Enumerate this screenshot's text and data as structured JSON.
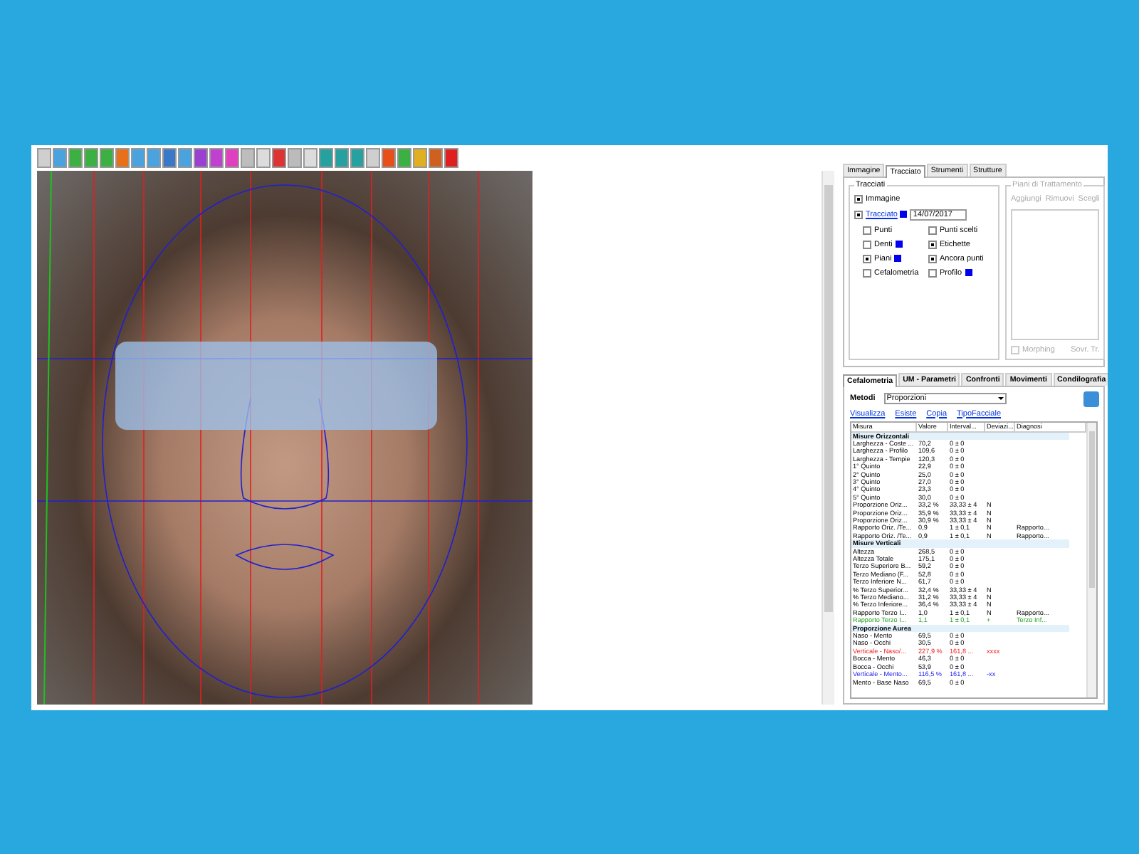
{
  "top_tabs": [
    {
      "label": "Immagine",
      "selected": false
    },
    {
      "label": "Tracciato",
      "selected": true
    },
    {
      "label": "Strumenti",
      "selected": false
    },
    {
      "label": "Strutture",
      "selected": false
    }
  ],
  "tracciati": {
    "title": "Tracciati",
    "options": [
      {
        "kind": "plain",
        "label": "Immagine",
        "checked": true
      },
      {
        "kind": "link",
        "label": "Tracciato",
        "checked": true,
        "swatch": true,
        "date": "14/07/2017"
      }
    ],
    "grid": [
      [
        {
          "label": "Punti",
          "checked": false
        },
        {
          "label": "Punti scelti",
          "checked": false
        }
      ],
      [
        {
          "label": "Denti",
          "checked": false,
          "swatch": true
        },
        {
          "label": "Etichette",
          "checked": true
        }
      ],
      [
        {
          "label": "Piani",
          "checked": true,
          "swatch": true
        },
        {
          "label": "Ancora punti",
          "checked": true
        }
      ],
      [
        {
          "label": "Cefalometria",
          "checked": false
        },
        {
          "label": "Profilo",
          "checked": false,
          "swatch": true
        }
      ]
    ]
  },
  "piani": {
    "title": "Piani di Trattamento",
    "headers": [
      "Aggiungi",
      "Rimuovi",
      "Scegli"
    ],
    "morphing": {
      "label": "Morphing",
      "checked": false
    },
    "footer": "Sovr. Tr."
  },
  "bottom_tabs": [
    {
      "label": "Cefalometria",
      "selected": true
    },
    {
      "label": "UM - Parametri",
      "selected": false
    },
    {
      "label": "Confronti",
      "selected": false
    },
    {
      "label": "Movimenti",
      "selected": false
    },
    {
      "label": "Condilografia",
      "selected": false
    }
  ],
  "metodi": {
    "label": "Metodi",
    "value": "Proporzioni"
  },
  "links": [
    "Visualizza",
    "Esiste",
    "Copia",
    "TipoFacciale"
  ],
  "table": {
    "columns": [
      "Misura",
      "Valore",
      "Interval...",
      "Deviazi...",
      "Diagnosi"
    ],
    "rows": [
      {
        "kind": "group",
        "cells": [
          "Misure Orizzontali"
        ]
      },
      {
        "kind": "row",
        "cells": [
          "Larghezza - Coste ...",
          "70,2",
          "0 ± 0",
          "",
          ""
        ]
      },
      {
        "kind": "row",
        "cells": [
          "Larghezza - Profilo",
          "109,6",
          "0 ± 0",
          "",
          ""
        ]
      },
      {
        "kind": "row",
        "cells": [
          "Larghezza - Tempie",
          "120,3",
          "0 ± 0",
          "",
          ""
        ]
      },
      {
        "kind": "row",
        "cells": [
          "1° Quinto",
          "22,9",
          "0 ± 0",
          "",
          ""
        ]
      },
      {
        "kind": "row",
        "cells": [
          "2° Quinto",
          "25,0",
          "0 ± 0",
          "",
          ""
        ]
      },
      {
        "kind": "row",
        "cells": [
          "3° Quinto",
          "27,0",
          "0 ± 0",
          "",
          ""
        ]
      },
      {
        "kind": "row",
        "cells": [
          "4° Quinto",
          "23,3",
          "0 ± 0",
          "",
          ""
        ]
      },
      {
        "kind": "row",
        "cells": [
          "5° Quinto",
          "30,0",
          "0 ± 0",
          "",
          ""
        ]
      },
      {
        "kind": "row",
        "cells": [
          "Proporzione Oriz...",
          "33,2 %",
          "33,33 ± 4",
          "N",
          ""
        ]
      },
      {
        "kind": "row",
        "cells": [
          "Proporzione Oriz...",
          "35,9 %",
          "33,33 ± 4",
          "N",
          ""
        ]
      },
      {
        "kind": "row",
        "cells": [
          "Proporzione Oriz...",
          "30,9 %",
          "33,33 ± 4",
          "N",
          ""
        ]
      },
      {
        "kind": "row",
        "cells": [
          "Rapporto Oriz. /Te...",
          "0,9",
          "1 ± 0,1",
          "N",
          "Rapporto..."
        ]
      },
      {
        "kind": "row",
        "cells": [
          "Rapporto Oriz. /Te...",
          "0,9",
          "1 ± 0,1",
          "N",
          "Rapporto..."
        ]
      },
      {
        "kind": "group",
        "cells": [
          "Misure Verticali"
        ]
      },
      {
        "kind": "row",
        "cells": [
          "Altezza",
          "268,5",
          "0 ± 0",
          "",
          ""
        ]
      },
      {
        "kind": "row",
        "cells": [
          "Altezza Totale",
          "175,1",
          "0 ± 0",
          "",
          ""
        ]
      },
      {
        "kind": "row",
        "cells": [
          "Terzo Superiore B...",
          "59,2",
          "0 ± 0",
          "",
          ""
        ]
      },
      {
        "kind": "row",
        "cells": [
          "Terzo Mediano (F...",
          "52,8",
          "0 ± 0",
          "",
          ""
        ]
      },
      {
        "kind": "row",
        "cells": [
          "Terzo Inferiore N...",
          "61,7",
          "0 ± 0",
          "",
          ""
        ]
      },
      {
        "kind": "row",
        "cells": [
          "% Terzo Superior...",
          "32,4 %",
          "33,33 ± 4",
          "N",
          ""
        ]
      },
      {
        "kind": "row",
        "cells": [
          "% Terzo Mediano...",
          "31,2 %",
          "33,33 ± 4",
          "N",
          ""
        ]
      },
      {
        "kind": "row",
        "cells": [
          "% Terzo Inferiore...",
          "36,4 %",
          "33,33 ± 4",
          "N",
          ""
        ]
      },
      {
        "kind": "row",
        "cells": [
          "Rapporto Terzo I...",
          "1,0",
          "1 ± 0,1",
          "N",
          "Rapporto..."
        ]
      },
      {
        "kind": "ok",
        "cells": [
          "Rapporto Terzo I...",
          "1,1",
          "1 ± 0,1",
          "+",
          "Terzo Inf..."
        ]
      },
      {
        "kind": "group",
        "cells": [
          "Proporzione Aurea"
        ]
      },
      {
        "kind": "row",
        "cells": [
          "Naso - Mento",
          "69,5",
          "0 ± 0",
          "",
          ""
        ]
      },
      {
        "kind": "row",
        "cells": [
          "Naso - Occhi",
          "30,5",
          "0 ± 0",
          "",
          ""
        ]
      },
      {
        "kind": "high",
        "cells": [
          "Verticale - Naso/...",
          "227,9 %",
          "161,8 ...",
          "xxxx",
          ""
        ]
      },
      {
        "kind": "row",
        "cells": [
          "Bocca - Mento",
          "46,3",
          "0 ± 0",
          "",
          ""
        ]
      },
      {
        "kind": "row",
        "cells": [
          "Bocca - Occhi",
          "53,9",
          "0 ± 0",
          "",
          ""
        ]
      },
      {
        "kind": "low",
        "cells": [
          "Verticale - Mento...",
          "116,5 %",
          "161,8 ...",
          "-xx",
          ""
        ]
      },
      {
        "kind": "row",
        "cells": [
          "Mento - Base Naso",
          "69,5",
          "0 ± 0",
          "",
          ""
        ]
      }
    ]
  }
}
